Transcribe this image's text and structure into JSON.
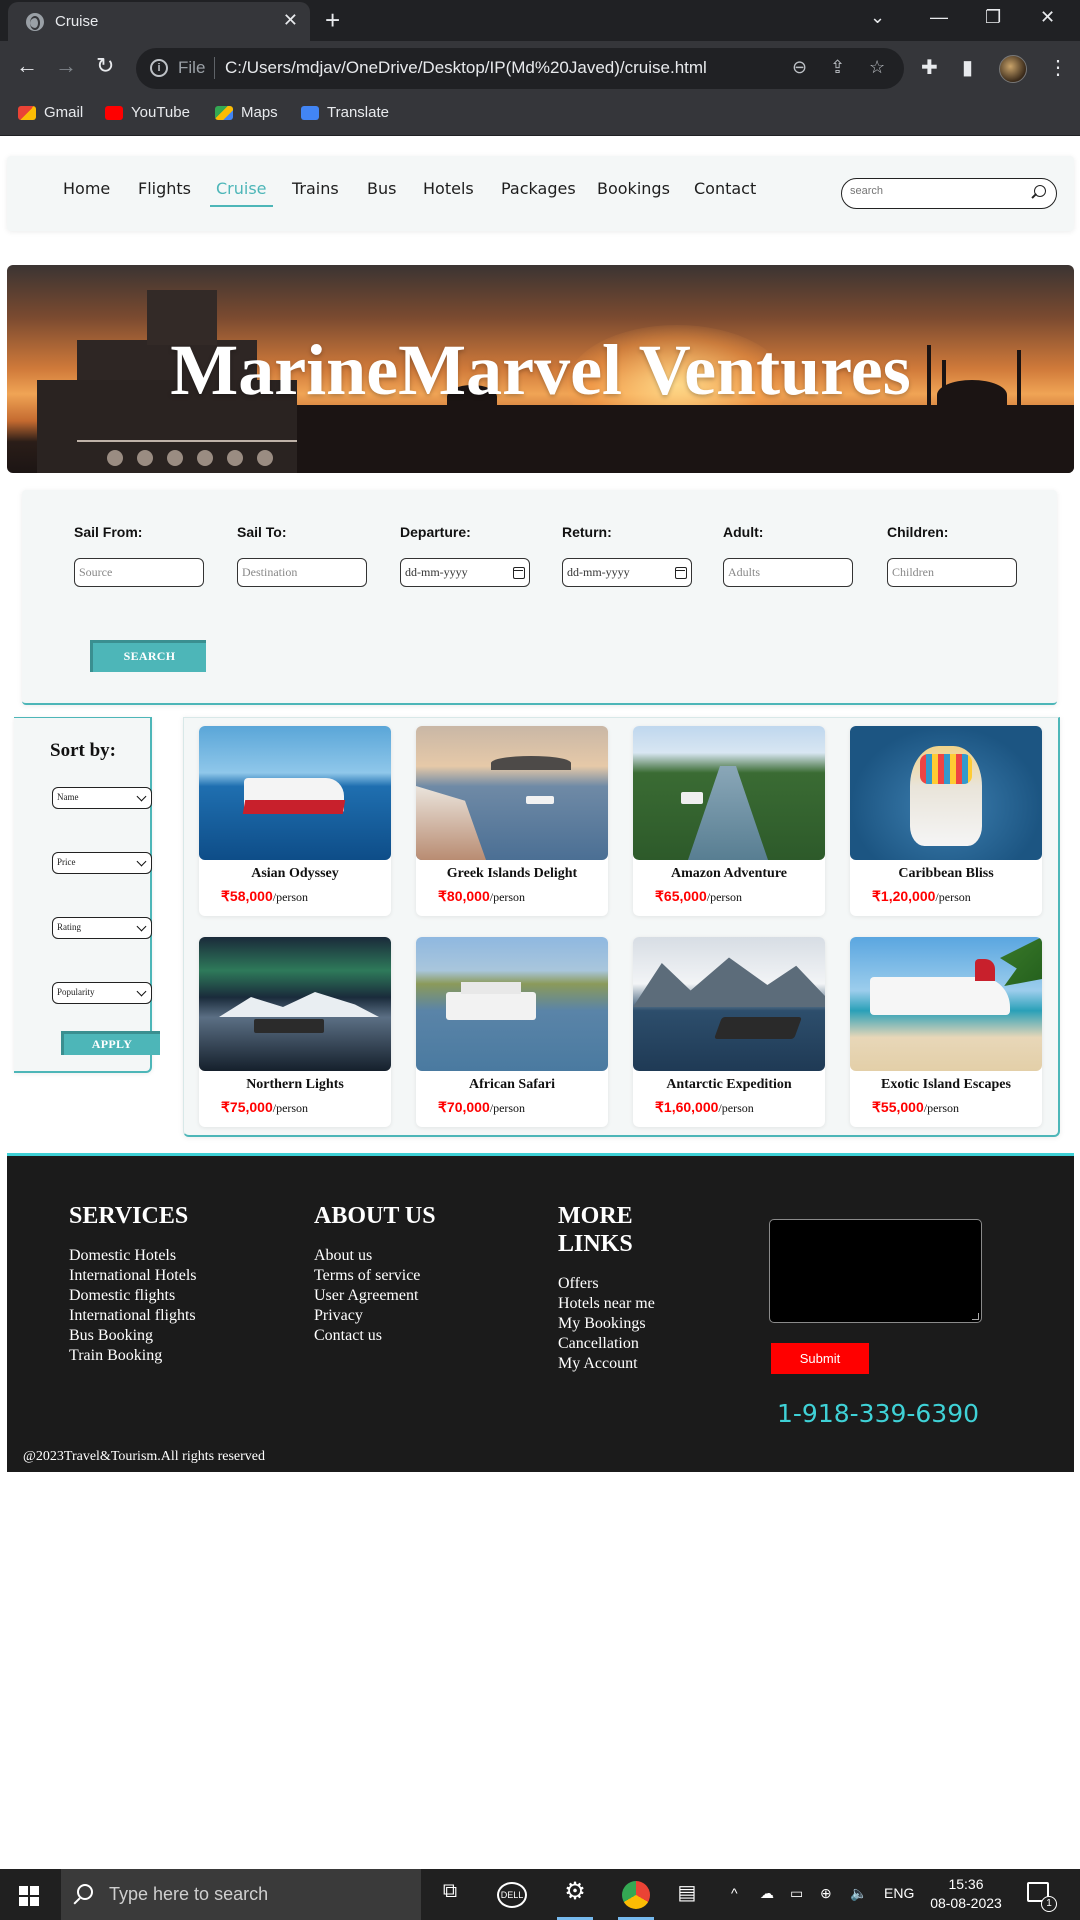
{
  "browser": {
    "tab_title": "Cruise",
    "url_scheme": "File",
    "url": "C:/Users/mdjav/OneDrive/Desktop/IP(Md%20Javed)/cruise.html",
    "bookmarks": [
      "Gmail",
      "YouTube",
      "Maps",
      "Translate"
    ]
  },
  "nav": {
    "links": [
      "Home",
      "Flights",
      "Cruise",
      "Trains",
      "Bus",
      "Hotels",
      "Packages",
      "Bookings",
      "Contact"
    ],
    "active": "Cruise",
    "search_placeholder": "search"
  },
  "hero": {
    "title": "MarineMarvel Ventures"
  },
  "search_form": {
    "fields": [
      {
        "label": "Sail From:",
        "placeholder": "Source"
      },
      {
        "label": "Sail To:",
        "placeholder": "Destination"
      },
      {
        "label": "Departure:",
        "placeholder": "dd-mm-yyyy"
      },
      {
        "label": "Return:",
        "placeholder": "dd-mm-yyyy"
      },
      {
        "label": "Adult:",
        "placeholder": "Adults"
      },
      {
        "label": "Children:",
        "placeholder": "Children"
      }
    ],
    "search_button": "SEARCH"
  },
  "sort": {
    "title": "Sort by:",
    "selects": [
      "Name",
      "Price",
      "Rating",
      "Popularity"
    ],
    "apply_button": "APPLY"
  },
  "cruises": [
    {
      "name": "Asian Odyssey",
      "price": "₹58,000",
      "unit": "/person"
    },
    {
      "name": "Greek Islands Delight",
      "price": "₹80,000",
      "unit": "/person"
    },
    {
      "name": "Amazon Adventure",
      "price": "₹65,000",
      "unit": "/person"
    },
    {
      "name": "Caribbean Bliss",
      "price": "₹1,20,000",
      "unit": "/person"
    },
    {
      "name": "Northern Lights",
      "price": "₹75,000",
      "unit": "/person"
    },
    {
      "name": "African Safari",
      "price": "₹70,000",
      "unit": "/person"
    },
    {
      "name": "Antarctic Expedition",
      "price": "₹1,60,000",
      "unit": "/person"
    },
    {
      "name": "Exotic Island Escapes",
      "price": "₹55,000",
      "unit": "/person"
    }
  ],
  "footer": {
    "services": {
      "heading": "SERVICES",
      "links": [
        "Domestic Hotels",
        "International Hotels",
        "Domestic flights",
        "International flights",
        "Bus Booking",
        "Train Booking"
      ]
    },
    "about": {
      "heading": "ABOUT US",
      "links": [
        "About us",
        "Terms of service",
        "User Agreement",
        "Privacy",
        "Contact us"
      ]
    },
    "more": {
      "heading_line1": "MORE",
      "heading_line2": "LINKS",
      "links": [
        "Offers",
        "Hotels near me",
        "My Bookings",
        "Cancellation",
        "My Account"
      ]
    },
    "submit_button": "Submit",
    "phone": "1-918-339-6390",
    "copyright": "@2023Travel&Tourism.All rights reserved"
  },
  "taskbar": {
    "search_placeholder": "Type here to search",
    "language": "ENG",
    "time": "15:36",
    "date": "08-08-2023",
    "notification_count": "1"
  },
  "colors": {
    "accent_teal": "#4db6b8",
    "price_red": "#ff0000",
    "phone_cyan": "#3fd1d6",
    "footer_bg": "#1b1b1b"
  }
}
